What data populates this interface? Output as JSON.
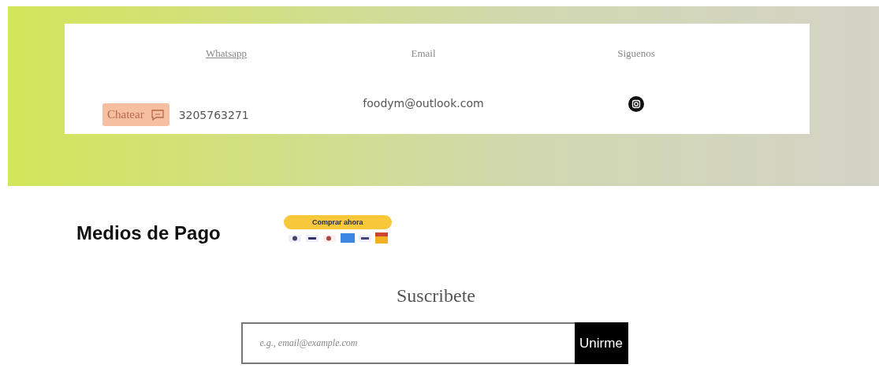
{
  "contact": {
    "columns": [
      {
        "heading": "Whatsapp",
        "underlined": true
      },
      {
        "heading": "Email",
        "underlined": false
      },
      {
        "heading": "Siguenos",
        "underlined": false
      }
    ],
    "chat_button": "Chatear",
    "phone": "3205763271",
    "email": "foodym@outlook.com"
  },
  "payment": {
    "title": "Medios de Pago",
    "button": "Comprar ahora"
  },
  "subscribe": {
    "title": "Suscribete",
    "placeholder": "e.g., email@example.com",
    "button": "Unirme"
  }
}
